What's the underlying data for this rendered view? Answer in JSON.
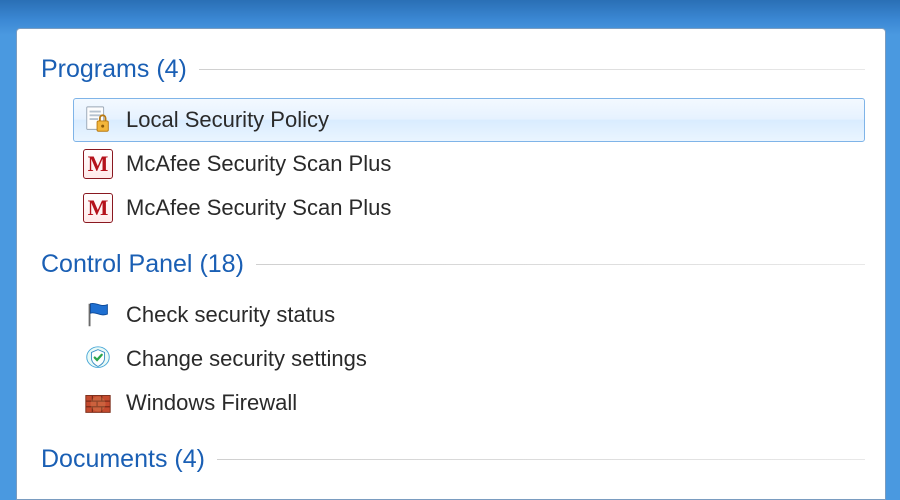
{
  "sections": {
    "programs": {
      "title": "Programs",
      "count": "(4)",
      "items": [
        {
          "label": "Local Security Policy",
          "icon": "local-security-policy-icon",
          "selected": true
        },
        {
          "label": "McAfee Security Scan Plus",
          "icon": "mcafee-icon",
          "selected": false
        },
        {
          "label": "McAfee Security Scan Plus",
          "icon": "mcafee-icon",
          "selected": false
        }
      ]
    },
    "controlPanel": {
      "title": "Control Panel",
      "count": "(18)",
      "items": [
        {
          "label": "Check security status",
          "icon": "flag-icon"
        },
        {
          "label": "Change security settings",
          "icon": "shield-check-icon"
        },
        {
          "label": "Windows Firewall",
          "icon": "firewall-icon"
        }
      ]
    },
    "documents": {
      "title": "Documents",
      "count": "(4)"
    }
  }
}
